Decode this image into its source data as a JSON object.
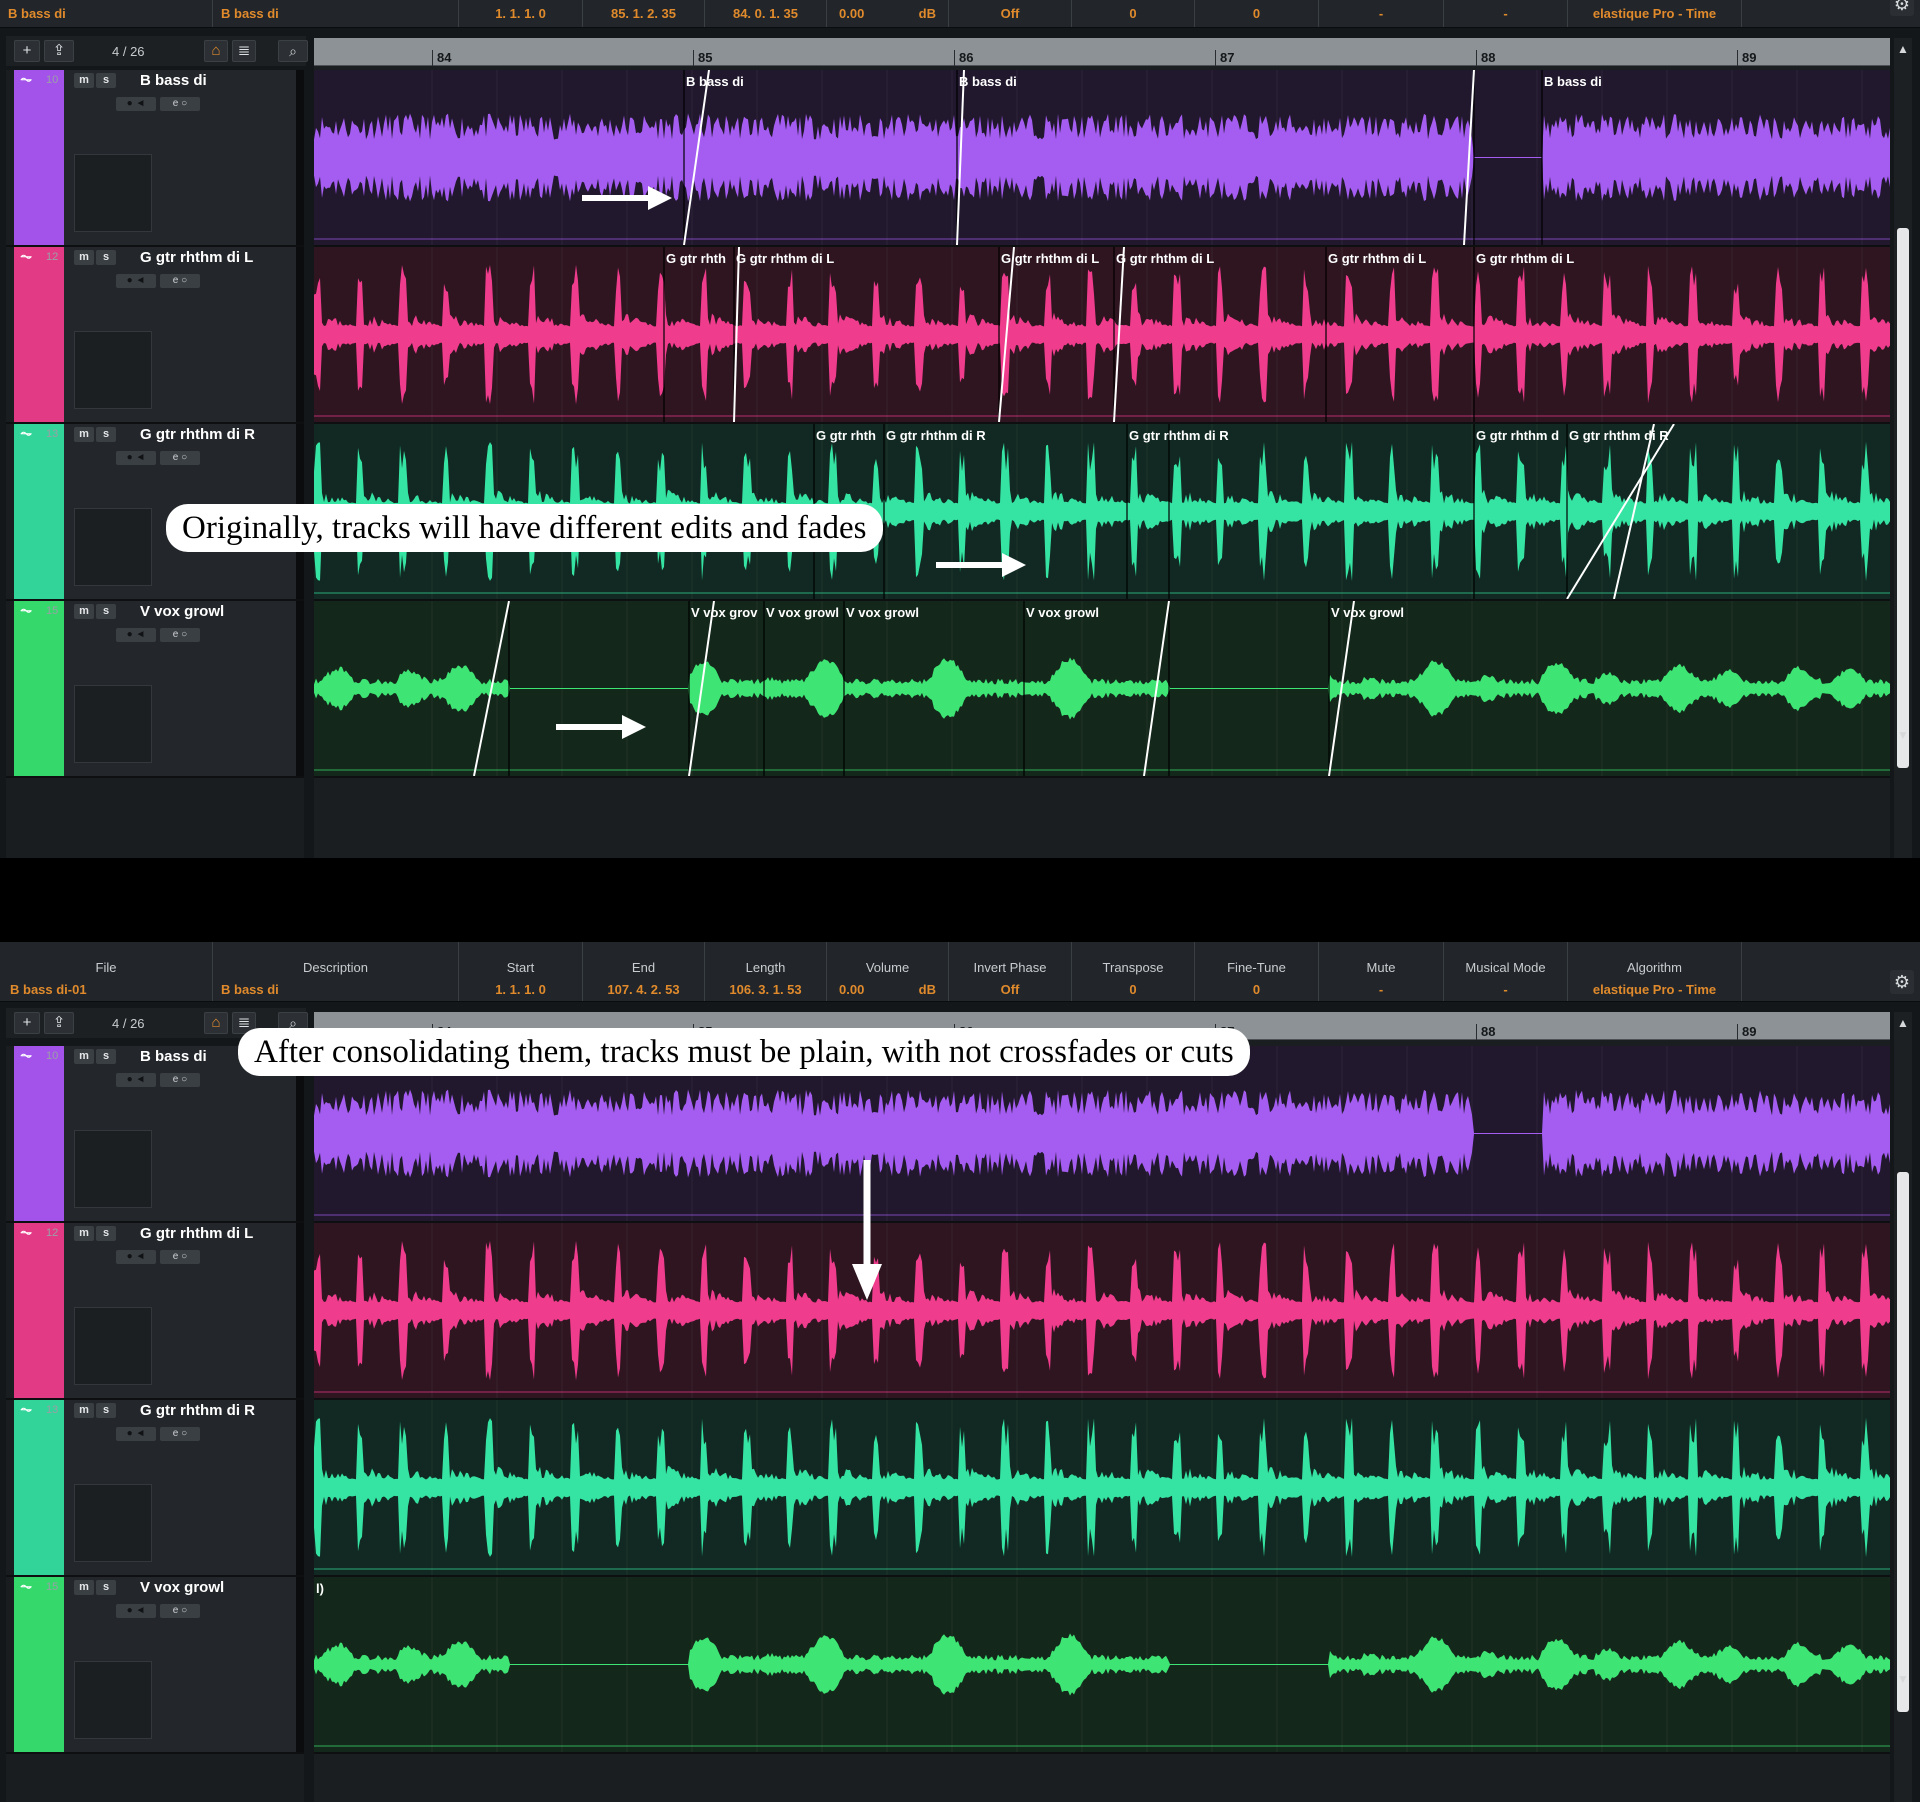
{
  "infobar": {
    "headers": [
      "File",
      "Description",
      "Start",
      "End",
      "Length",
      "Volume",
      "Invert Phase",
      "Transpose",
      "Fine-Tune",
      "Mute",
      "Musical Mode",
      "Algorithm"
    ],
    "top_values": [
      "B bass di",
      "B bass di",
      "1. 1. 1.   0",
      "85. 1. 2. 35",
      "84. 0. 1. 35",
      "0.00",
      "dB",
      "Off",
      "0",
      "0",
      "-",
      "-",
      "elastique Pro - Time"
    ],
    "bottom_values": [
      "B bass di-01",
      "B bass di",
      "1. 1. 1.   0",
      "107. 4. 2. 53",
      "106. 3. 1. 53",
      "0.00",
      "dB",
      "Off",
      "0",
      "0",
      "-",
      "-",
      "elastique Pro - Time"
    ]
  },
  "toolbar": {
    "add": "+",
    "folder": "⇪",
    "count": "4 / 26",
    "home": "⌂",
    "list": "≣",
    "search": "⌕"
  },
  "ruler": {
    "bars": [
      "84",
      "85",
      "86",
      "87",
      "88",
      "89"
    ]
  },
  "tracks": [
    {
      "num": "10",
      "name": "B bass di",
      "color": "#a352ea",
      "wave": "#a45df0",
      "bg": "#21182e"
    },
    {
      "num": "12",
      "name": "G gtr rhthm di L",
      "color": "#e33a86",
      "wave": "#f03c8d",
      "bg": "#2e1520"
    },
    {
      "num": "13",
      "name": "G gtr rhthm di R",
      "color": "#33d49a",
      "wave": "#35e3a3",
      "bg": "#112922"
    },
    {
      "num": "15",
      "name": "V vox growl",
      "color": "#35d96b",
      "wave": "#3ee574",
      "bg": "#13271a"
    }
  ],
  "buttons": {
    "mute": "m",
    "solo": "s",
    "rec": "●",
    "monitor": "◄",
    "edit": "e",
    "read": "○"
  },
  "events_top": {
    "bass": [
      "B bass di",
      "B bass di",
      "B bass di"
    ],
    "gtrL": [
      "G gtr rhth",
      "G gtr rhthm di L",
      "G gtr rhthm di L",
      "G gtr rhthm di L",
      "G gtr rhthm di L",
      "G gtr rhthm di L"
    ],
    "gtrR": [
      "G gtr rhth",
      "G gtr rhthm di R",
      "G gtr rhthm di R",
      "G gtr rhthm d",
      "G gtr rhthm di R"
    ],
    "vox": [
      "V vox grov",
      "V vox growl",
      "V vox growl",
      "V vox growl",
      "V vox growl"
    ]
  },
  "vox_bottom_label": "l)",
  "annotations": {
    "top": "Originally, tracks will have different edits and fades",
    "bottom": "After consolidating them, tracks must be plain, with not crossfades or cuts"
  },
  "icons": {
    "gear": "gear-icon",
    "wave": "waveform-icon",
    "arrow": "arrow-icon"
  }
}
